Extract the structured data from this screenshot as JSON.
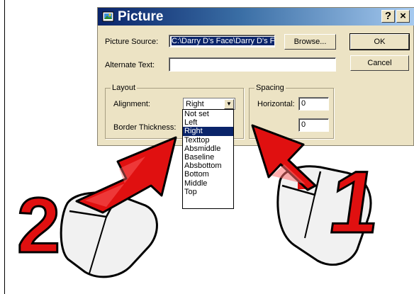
{
  "dialog": {
    "title": "Picture",
    "help_label": "?",
    "close_label": "×",
    "picture_source_label": "Picture Source:",
    "picture_source_value": "C:\\Darry D's Face\\Darry D's F",
    "browse_label": "Browse...",
    "ok_label": "OK",
    "alternate_text_label": "Alternate Text:",
    "alternate_text_value": "",
    "cancel_label": "Cancel",
    "layout_group_label": "Layout",
    "alignment_label": "Alignment:",
    "alignment_value": "Right",
    "border_thickness_label": "Border Thickness:",
    "spacing_group_label": "Spacing",
    "horizontal_label": "Horizontal:",
    "horizontal_value": "0",
    "vertical_value": "0"
  },
  "alignment_options": [
    "Not set",
    "Left",
    "Right",
    "Texttop",
    "Absmiddle",
    "Baseline",
    "Absbottom",
    "Bottom",
    "Middle",
    "Top"
  ],
  "selected_option": "Right",
  "annotations": {
    "number_1": "1",
    "number_2": "2"
  },
  "icons": {
    "app": "picture-icon",
    "arrow": "pointer-arrow-icon",
    "mouse": "mouse-icon"
  },
  "colors": {
    "dialog_bg": "#ece3c4",
    "title_start": "#0a246a",
    "title_end": "#a6caf0",
    "selection": "#0a246a",
    "arrow_red": "#e01010"
  }
}
